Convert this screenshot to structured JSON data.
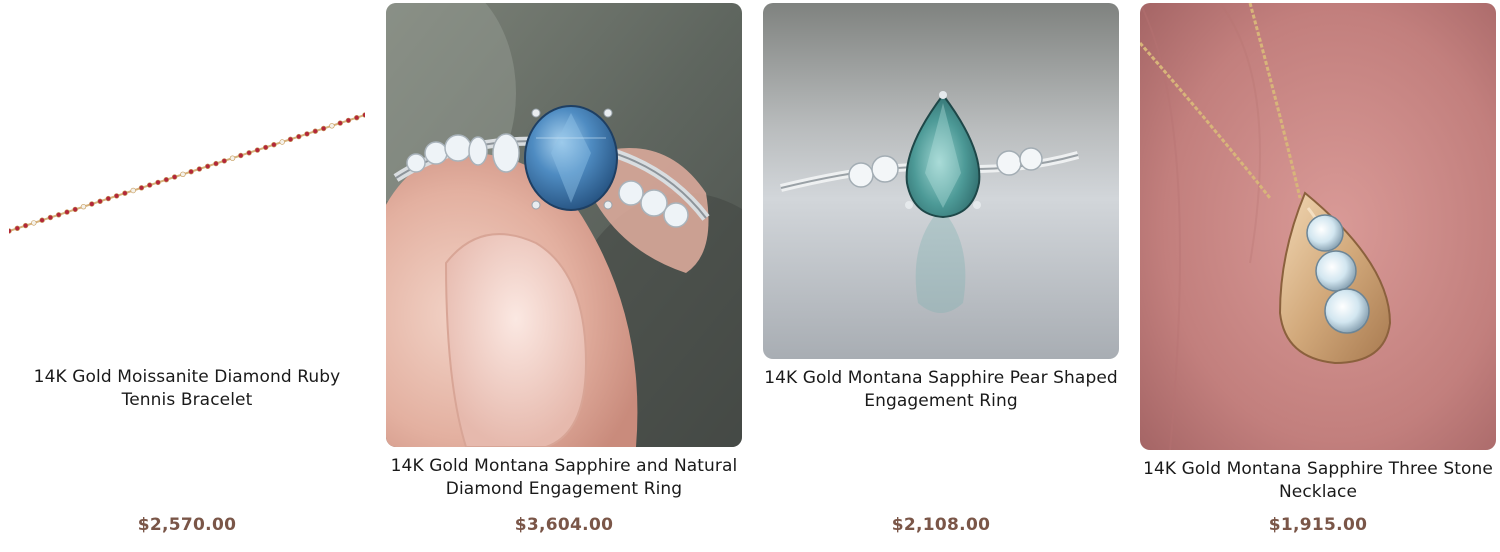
{
  "products": [
    {
      "name": "14K Gold Moissanite Diamond Ruby Tennis Bracelet",
      "price": "$2,570.00",
      "image_subject": "ruby tennis bracelet"
    },
    {
      "name": "14K Gold Montana Sapphire and Natural Diamond Engagement Ring",
      "price": "$3,604.00",
      "image_subject": "blue oval sapphire ring held between fingers"
    },
    {
      "name": "14K Gold Montana Sapphire Pear Shaped Engagement Ring",
      "price": "$2,108.00",
      "image_subject": "teal pear sapphire ring on reflective surface"
    },
    {
      "name": "14K Gold Montana Sapphire Three Stone Necklace",
      "price": "$1,915.00",
      "image_subject": "gold teardrop pendant with three stones"
    }
  ]
}
